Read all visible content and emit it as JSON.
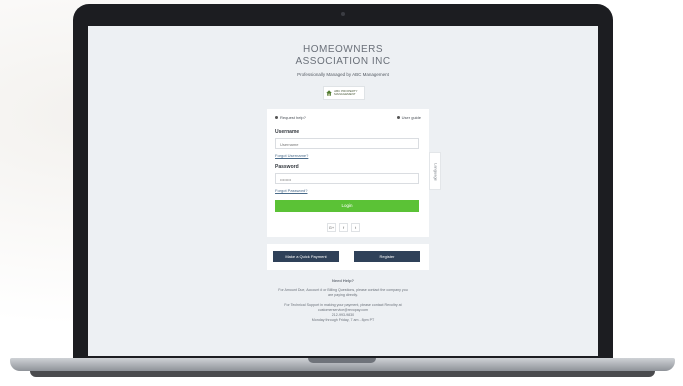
{
  "header": {
    "title_line1": "HOMEOWNERS",
    "title_line2": "ASSOCIATION INC",
    "subtitle": "Professionally Managed by ABC Management",
    "logo_text": "ABC PROPERTY MANAGEMENT"
  },
  "login_card": {
    "request_help": "Request help?",
    "user_guide": "User guide",
    "username_label": "Username",
    "username_placeholder": "Username",
    "forgot_username": "Forgot Username?",
    "password_label": "Password",
    "password_placeholder": "••••••••",
    "forgot_password": "Forgot Password?",
    "login_button": "Login",
    "social": [
      "G+",
      "f",
      "t"
    ]
  },
  "language_tab": "Language",
  "actions": {
    "quick_payment": "Make a Quick Payment",
    "register": "Register"
  },
  "help": {
    "heading": "Need Help?",
    "line1": "For Amount Due, Account # or Billing Questions, please contact the company you",
    "line2": "are paying directly.",
    "line3": "For Technical Support in making your payment, please contact Revoltry at",
    "line4": "customerservice@revopay.com",
    "line5": "212-993-9830",
    "line6": "Monday through Friday, 7 am - 8pm PT"
  },
  "colors": {
    "login_green": "#5bc236",
    "action_navy": "#2f4159",
    "screen_bg": "#edf0f3"
  }
}
